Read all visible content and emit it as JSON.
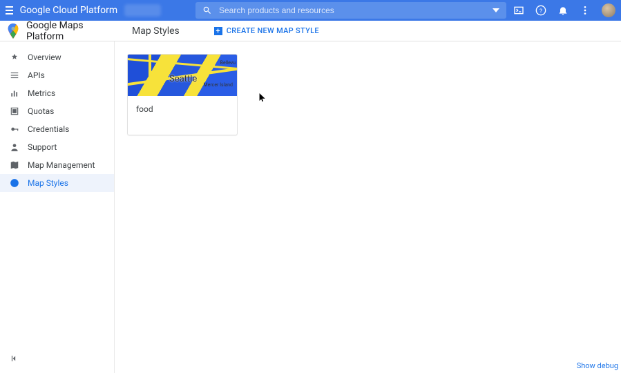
{
  "topbar": {
    "brand": "Google Cloud Platform",
    "search_placeholder": "Search products and resources"
  },
  "subbar": {
    "product": "Google Maps Platform",
    "page_title": "Map Styles",
    "create_label": "CREATE NEW MAP STYLE"
  },
  "sidebar": {
    "items": [
      {
        "label": "Overview"
      },
      {
        "label": "APIs"
      },
      {
        "label": "Metrics"
      },
      {
        "label": "Quotas"
      },
      {
        "label": "Credentials"
      },
      {
        "label": "Support"
      },
      {
        "label": "Map Management"
      },
      {
        "label": "Map Styles"
      }
    ]
  },
  "content": {
    "cards": [
      {
        "name": "food",
        "thumb_city": "Seattle",
        "thumb_label_right_top": "Bellevu",
        "thumb_label_right_mid": "Mercer Island"
      }
    ]
  },
  "footer": {
    "debug": "Show debug"
  }
}
